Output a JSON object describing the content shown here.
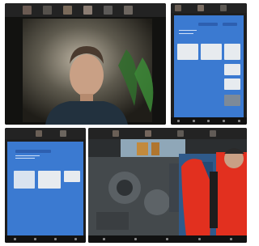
{
  "panels": {
    "main": {
      "label": "webcam-video-panel"
    },
    "slides_tr": {
      "label": "shared-slides-panel-top-right"
    },
    "slides_bl": {
      "label": "shared-slides-panel-bottom-left"
    },
    "engine": {
      "label": "engine-video-panel"
    }
  },
  "colors": {
    "background": "#1c1c1c",
    "slide_blue": "#3b7ad1",
    "bars": "#232323",
    "jacket_red": "#e2301f"
  }
}
